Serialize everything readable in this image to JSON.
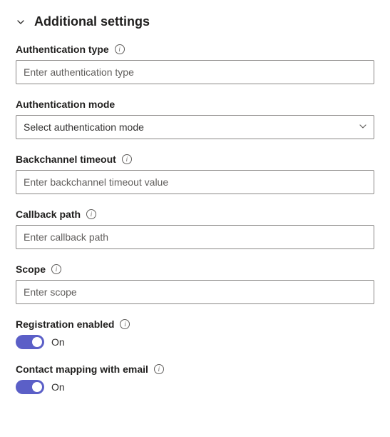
{
  "section": {
    "title": "Additional settings"
  },
  "fields": {
    "authType": {
      "label": "Authentication type",
      "placeholder": "Enter authentication type",
      "value": ""
    },
    "authMode": {
      "label": "Authentication mode",
      "placeholder": "Select authentication mode",
      "value": ""
    },
    "backchannelTimeout": {
      "label": "Backchannel timeout",
      "placeholder": "Enter backchannel timeout value",
      "value": ""
    },
    "callbackPath": {
      "label": "Callback path",
      "placeholder": "Enter callback path",
      "value": ""
    },
    "scope": {
      "label": "Scope",
      "placeholder": "Enter scope",
      "value": ""
    },
    "registrationEnabled": {
      "label": "Registration enabled",
      "stateLabel": "On",
      "enabled": true
    },
    "contactMapping": {
      "label": "Contact mapping with email",
      "stateLabel": "On",
      "enabled": true
    }
  },
  "colors": {
    "toggleOn": "#5b5fc7"
  }
}
